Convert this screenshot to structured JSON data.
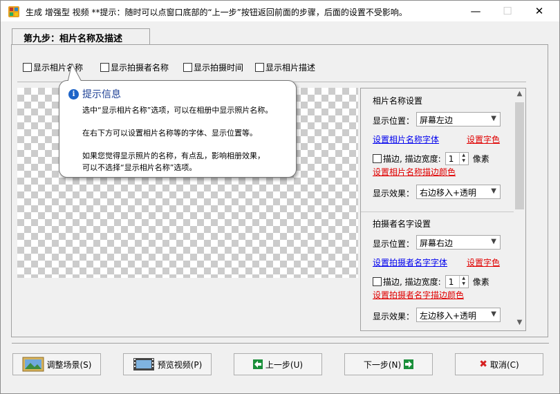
{
  "window": {
    "title": "生成 增强型 视频  **提示：随时可以点窗口底部的“上一步”按钮返回前面的步骤，后面的设置不受影响。",
    "min_glyph": "—",
    "max_glyph": "☐",
    "close_glyph": "✕"
  },
  "step_tab": "第九步：相片名称及描述",
  "options": [
    {
      "label": "显示相片名称",
      "checked": false
    },
    {
      "label": "显示拍摄者名称",
      "checked": false
    },
    {
      "label": "显示拍摄时间",
      "checked": false
    },
    {
      "label": "显示相片描述",
      "checked": false
    }
  ],
  "tooltip": {
    "title": "提示信息",
    "icon_glyph": "i",
    "line1": "选中“显示相片名称”选项，可以在相册中显示照片名称。",
    "line2": "在右下方可以设置相片名称等的字体、显示位置等。",
    "line3": "如果您觉得显示照片的名称，有点乱，影响相册效果，",
    "line4": "可以不选择“显示相片名称”选项。"
  },
  "photo_name_settings": {
    "title": "相片名称设置",
    "position_label": "显示位置：",
    "position_value": "屏幕左边",
    "font_link": "设置相片名称字体",
    "color_link": "设置字色",
    "border_label": "描边, 描边宽度:",
    "border_width": "1",
    "border_unit": "像素",
    "border_color_link": "设置相片名称描边颜色",
    "effect_label": "显示效果：",
    "effect_value": "右边移入+透明"
  },
  "photographer_settings": {
    "title": "拍摄者名字设置",
    "position_label": "显示位置：",
    "position_value": "屏幕右边",
    "font_link": "设置拍摄者名字字体",
    "color_link": "设置字色",
    "border_label": "描边, 描边宽度:",
    "border_width": "1",
    "border_unit": "像素",
    "border_color_link": "设置拍摄者名字描边颜色",
    "effect_label": "显示效果：",
    "effect_value": "左边移入+透明"
  },
  "buttons": {
    "adjust_scene": "调整场景(S)",
    "preview_video": "预览视频(P)",
    "prev_step": "上一步(U)",
    "next_step": "下一步(N)",
    "cancel": "取消(C)"
  },
  "colors": {
    "accent_blue": "#0000ee",
    "link_red": "#e00000",
    "arrow_green": "#1a8f3a",
    "cancel_red": "#d62020"
  }
}
